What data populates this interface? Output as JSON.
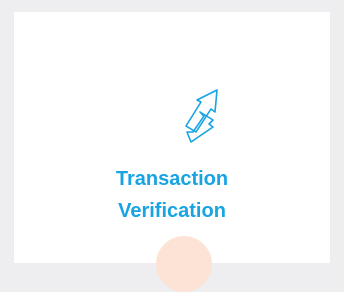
{
  "card": {
    "icon": "exchange-arrows-icon",
    "title_line1": "Transaction",
    "title_line2": "Verification"
  },
  "colors": {
    "background": "#eeeef0",
    "card": "#ffffff",
    "accent": "#18a4e3",
    "peek_circle": "#fde3d5"
  }
}
